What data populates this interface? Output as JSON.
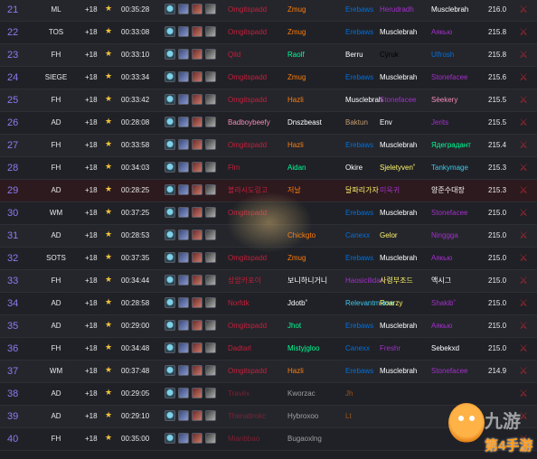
{
  "colors": {
    "rank": "#8b7cf0",
    "star": "#f3c33c",
    "faction": "#b4232c",
    "deathknight": "#c41f3b",
    "hunter": "#abd473",
    "mage": "#40c7eb",
    "monk": "#00ff96",
    "paladin": "#f58cba",
    "priest": "#ffffff",
    "rogue": "#fff569",
    "shaman": "#0070de",
    "warlock": "#8787ed",
    "warrior": "#c79c6e",
    "druid": "#ff7d0a",
    "demonhunter": "#a330c9"
  },
  "affix_icons": [
    "fortified-icon",
    "volcanic-icon",
    "bolstering-icon",
    "infested-icon"
  ],
  "faction_icon": "horde-icon",
  "star_glyph": "★",
  "faction_glyph": "⚔",
  "watermark": {
    "text1": "九游",
    "text2": "第4手游"
  },
  "rows": [
    {
      "rank": "21",
      "dungeon": "ML",
      "level": "+18",
      "time": "00:35:28",
      "members": [
        {
          "name": "Omgitspadd",
          "cls": "c-dk"
        },
        {
          "name": "Zmug",
          "cls": "c-druid"
        },
        {
          "name": "Erebaws",
          "cls": "c-sham"
        },
        {
          "name": "Herudradh",
          "cls": "c-dh"
        },
        {
          "name": "Musclebrah",
          "cls": "c-priest"
        }
      ],
      "score": "216.0"
    },
    {
      "rank": "22",
      "dungeon": "TOS",
      "level": "+18",
      "time": "00:33:08",
      "members": [
        {
          "name": "Omgitspadd",
          "cls": "c-dk"
        },
        {
          "name": "Zmug",
          "cls": "c-druid"
        },
        {
          "name": "Erebaws",
          "cls": "c-sham"
        },
        {
          "name": "Musclebrah",
          "cls": "c-priest"
        },
        {
          "name": "Аякью",
          "cls": "c-dh"
        }
      ],
      "score": "215.8"
    },
    {
      "rank": "23",
      "dungeon": "FH",
      "level": "+18",
      "time": "00:33:10",
      "members": [
        {
          "name": "Qild",
          "cls": "c-dk"
        },
        {
          "name": "Raolf",
          "cls": "c-monk"
        },
        {
          "name": "Berru",
          "cls": "c-priest"
        },
        {
          "name": "Cÿruk",
          "cls": "c-warrior"
        },
        {
          "name": "Ulfrosh",
          "cls": "c-sham"
        }
      ],
      "score": "215.8"
    },
    {
      "rank": "24",
      "dungeon": "SIEGE",
      "level": "+18",
      "time": "00:33:34",
      "members": [
        {
          "name": "Omgitspadd",
          "cls": "c-dk"
        },
        {
          "name": "Zmug",
          "cls": "c-druid"
        },
        {
          "name": "Erebaws",
          "cls": "c-sham"
        },
        {
          "name": "Musclebrah",
          "cls": "c-priest"
        },
        {
          "name": "Stonefacee",
          "cls": "c-dh"
        }
      ],
      "score": "215.6"
    },
    {
      "rank": "25",
      "dungeon": "FH",
      "level": "+18",
      "time": "00:33:42",
      "members": [
        {
          "name": "Omgitspadd",
          "cls": "c-dk"
        },
        {
          "name": "Hazli",
          "cls": "c-druid"
        },
        {
          "name": "Musclebrah",
          "cls": "c-priest"
        },
        {
          "name": "Stonefacee",
          "cls": "c-dh"
        },
        {
          "name": "Sèekery",
          "cls": "c-pal"
        }
      ],
      "score": "215.5"
    },
    {
      "rank": "26",
      "dungeon": "AD",
      "level": "+18",
      "time": "00:28:08",
      "members": [
        {
          "name": "Badboybeefy",
          "cls": "c-pal"
        },
        {
          "name": "Dnszbeast",
          "cls": "c-priest"
        },
        {
          "name": "Baktun",
          "cls": "c-war"
        },
        {
          "name": "Env",
          "cls": "c-priest"
        },
        {
          "name": "Jerits",
          "cls": "c-dh"
        }
      ],
      "score": "215.5"
    },
    {
      "rank": "27",
      "dungeon": "FH",
      "level": "+18",
      "time": "00:33:58",
      "members": [
        {
          "name": "Omgitspadd",
          "cls": "c-dk"
        },
        {
          "name": "Hazli",
          "cls": "c-druid"
        },
        {
          "name": "Erebaws",
          "cls": "c-sham"
        },
        {
          "name": "Musclebrah",
          "cls": "c-priest"
        },
        {
          "name": "Ядеградант",
          "cls": "c-monk"
        }
      ],
      "score": "215.4"
    },
    {
      "rank": "28",
      "dungeon": "FH",
      "level": "+18",
      "time": "00:34:03",
      "members": [
        {
          "name": "Flm",
          "cls": "c-dk"
        },
        {
          "name": "Aidan",
          "cls": "c-monk"
        },
        {
          "name": "Okire",
          "cls": "c-priest"
        },
        {
          "name": "Sjeletyven˚",
          "cls": "c-rogue"
        },
        {
          "name": "Tankymage",
          "cls": "c-mage"
        }
      ],
      "score": "215.3"
    },
    {
      "rank": "29",
      "dungeon": "AD",
      "level": "+18",
      "time": "00:28:25",
      "members": [
        {
          "name": "볼라시도링고",
          "cls": "c-dk"
        },
        {
          "name": "저날",
          "cls": "c-druid"
        },
        {
          "name": "달파리가자",
          "cls": "c-rogue"
        },
        {
          "name": "미욱귀",
          "cls": "c-dh"
        },
        {
          "name": "양준수대장",
          "cls": "c-priest"
        }
      ],
      "score": "215.3"
    },
    {
      "rank": "30",
      "dungeon": "WM",
      "level": "+18",
      "time": "00:37:25",
      "members": [
        {
          "name": "Omgitspadd",
          "cls": "c-dk"
        },
        {
          "name": "",
          "cls": "c-druid"
        },
        {
          "name": "Erebaws",
          "cls": "c-sham"
        },
        {
          "name": "Musclebrah",
          "cls": "c-priest"
        },
        {
          "name": "Stonefacee",
          "cls": "c-dh"
        }
      ],
      "score": "215.0"
    },
    {
      "rank": "31",
      "dungeon": "AD",
      "level": "+18",
      "time": "00:28:53",
      "members": [
        {
          "name": "",
          "cls": "c-dk"
        },
        {
          "name": "Chickgto",
          "cls": "c-druid"
        },
        {
          "name": "Canexx",
          "cls": "c-sham"
        },
        {
          "name": "Gelor",
          "cls": "c-rogue"
        },
        {
          "name": "Ninggga",
          "cls": "c-dh"
        }
      ],
      "score": "215.0"
    },
    {
      "rank": "32",
      "dungeon": "SOTS",
      "level": "+18",
      "time": "00:37:35",
      "members": [
        {
          "name": "Omgitspadd",
          "cls": "c-dk"
        },
        {
          "name": "Zmug",
          "cls": "c-druid"
        },
        {
          "name": "Erebaws",
          "cls": "c-sham"
        },
        {
          "name": "Musclebrah",
          "cls": "c-priest"
        },
        {
          "name": "Аякью",
          "cls": "c-dh"
        }
      ],
      "score": "215.0"
    },
    {
      "rank": "33",
      "dungeon": "FH",
      "level": "+18",
      "time": "00:34:44",
      "members": [
        {
          "name": "상암카포이",
          "cls": "c-dk"
        },
        {
          "name": "보니하니거니",
          "cls": "c-priest"
        },
        {
          "name": "Haosicilidan",
          "cls": "c-dh"
        },
        {
          "name": "사령부조드",
          "cls": "c-rogue"
        },
        {
          "name": "액시그",
          "cls": "c-priest"
        }
      ],
      "score": "215.0"
    },
    {
      "rank": "34",
      "dungeon": "AD",
      "level": "+18",
      "time": "00:28:58",
      "members": [
        {
          "name": "Norfdk",
          "cls": "c-dk"
        },
        {
          "name": "Jdotb˚",
          "cls": "c-priest"
        },
        {
          "name": "Relevantmeme",
          "cls": "c-mage"
        },
        {
          "name": "Roarzy",
          "cls": "c-rogue"
        },
        {
          "name": "Shakib˚",
          "cls": "c-dh"
        }
      ],
      "score": "215.0"
    },
    {
      "rank": "35",
      "dungeon": "AD",
      "level": "+18",
      "time": "00:29:00",
      "members": [
        {
          "name": "Omgitspadd",
          "cls": "c-dk"
        },
        {
          "name": "Jhot",
          "cls": "c-monk"
        },
        {
          "name": "Erebaws",
          "cls": "c-sham"
        },
        {
          "name": "Musclebrah",
          "cls": "c-priest"
        },
        {
          "name": "Аякью",
          "cls": "c-dh"
        }
      ],
      "score": "215.0"
    },
    {
      "rank": "36",
      "dungeon": "FH",
      "level": "+18",
      "time": "00:34:48",
      "members": [
        {
          "name": "Dadtarl",
          "cls": "c-dk"
        },
        {
          "name": "Mistyjgloo",
          "cls": "c-monk"
        },
        {
          "name": "Canexx",
          "cls": "c-sham"
        },
        {
          "name": "Freshr",
          "cls": "c-dh"
        },
        {
          "name": "Sebekxd",
          "cls": "c-priest"
        }
      ],
      "score": "215.0"
    },
    {
      "rank": "37",
      "dungeon": "WM",
      "level": "+18",
      "time": "00:37:48",
      "members": [
        {
          "name": "Omgitspadd",
          "cls": "c-dk"
        },
        {
          "name": "Hazli",
          "cls": "c-druid"
        },
        {
          "name": "Erebaws",
          "cls": "c-sham"
        },
        {
          "name": "Musclebrah",
          "cls": "c-priest"
        },
        {
          "name": "Stonefacee",
          "cls": "c-dh"
        }
      ],
      "score": "214.9"
    },
    {
      "rank": "38",
      "dungeon": "AD",
      "level": "+18",
      "time": "00:29:05",
      "members": [
        {
          "name": "Travéx",
          "cls": "c-dk"
        },
        {
          "name": "Kworzac",
          "cls": "c-priest"
        },
        {
          "name": "Jh",
          "cls": "c-druid"
        },
        {
          "name": "",
          "cls": "c-priest"
        },
        {
          "name": "",
          "cls": "c-priest"
        }
      ],
      "score": ""
    },
    {
      "rank": "39",
      "dungeon": "AD",
      "level": "+18",
      "time": "00:29:10",
      "members": [
        {
          "name": "Thenattrokc",
          "cls": "c-dk"
        },
        {
          "name": "Hybroxoo",
          "cls": "c-priest"
        },
        {
          "name": "Lt",
          "cls": "c-druid"
        },
        {
          "name": "",
          "cls": "c-priest"
        },
        {
          "name": "",
          "cls": "c-priest"
        }
      ],
      "score": ""
    },
    {
      "rank": "40",
      "dungeon": "FH",
      "level": "+18",
      "time": "00:35:00",
      "members": [
        {
          "name": "Mianbbao",
          "cls": "c-dk"
        },
        {
          "name": "Bugaoxlng",
          "cls": "c-priest"
        },
        {
          "name": "",
          "cls": "c-priest"
        },
        {
          "name": "",
          "cls": "c-priest"
        },
        {
          "name": "",
          "cls": "c-priest"
        }
      ],
      "score": ""
    }
  ]
}
